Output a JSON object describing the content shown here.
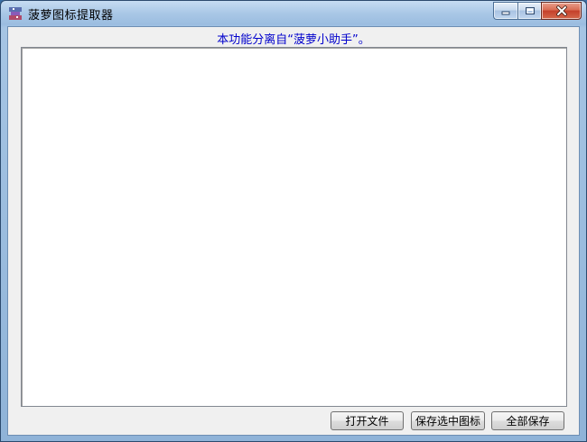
{
  "window": {
    "title": "菠萝图标提取器",
    "controls": {
      "minimize_icon": "minimize-icon",
      "maximize_icon": "maximize-icon",
      "close_icon": "close-icon"
    }
  },
  "notice": "本功能分离自“菠萝小助手”。",
  "buttons": {
    "open_file": "打开文件",
    "save_selected": "保存选中图标",
    "save_all": "全部保存"
  },
  "colors": {
    "notice_text": "#0000cc",
    "close_button": "#c4402a"
  }
}
